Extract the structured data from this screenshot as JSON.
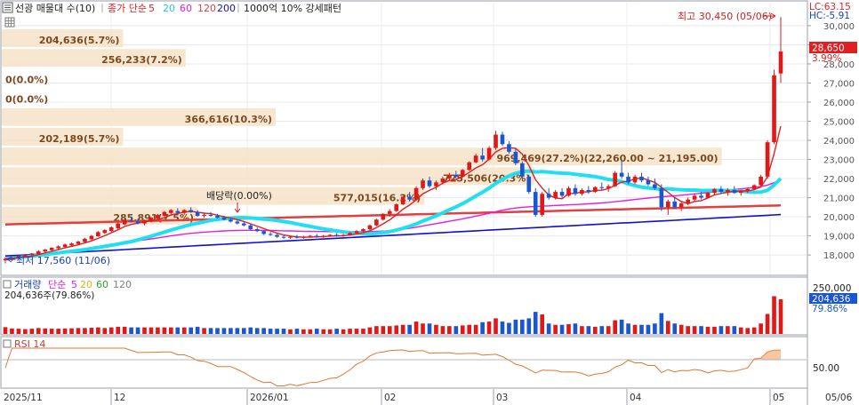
{
  "header": {
    "title": "선광 매물대 수(10)",
    "ma_label": "종가 단순",
    "ma_periods": [
      "5",
      "20",
      "60",
      "120",
      "200"
    ],
    "ma_colors": [
      "#e02020",
      "#20d0e0",
      "#e020e0",
      "#e04040",
      "#1010d0"
    ],
    "pattern_label": "1000억 10% 강세패턴",
    "lc": "LC:63.15",
    "hc": "HC:-5.91"
  },
  "price_panel": {
    "y_ticks": [
      "30,000",
      "29,000",
      "28,000",
      "27,000",
      "26,000",
      "25,000",
      "24,000",
      "23,000",
      "22,000",
      "21,000",
      "20,000",
      "19,000",
      "18,000"
    ],
    "current_price": "28,650",
    "current_change": "3.99%",
    "high_annotation": "최고 30,450 (05/06)",
    "low_annotation": "최저 17,560 (11/06)",
    "dividend_annotation": "배당락(0.00%)",
    "volume_profile": [
      {
        "label": "204,636(5.7%)",
        "width": 0.155
      },
      {
        "label": "256,233(7.2%)",
        "width": 0.235
      },
      {
        "label": "0(0.0%)",
        "width": 0
      },
      {
        "label": "0(0.0%)",
        "width": 0
      },
      {
        "label": "366,616(10.3%)",
        "width": 0.35
      },
      {
        "label": "202,189(5.7%)",
        "width": 0.155
      },
      {
        "label": "969,469(27.2%)(22,260.00 ~ 21,195.00)",
        "width": 0.92
      },
      {
        "label": "725,506(20.3%)",
        "width": 0.68
      },
      {
        "label": "577,015(16.2%)",
        "width": 0.54
      },
      {
        "label": "285,891(7.5%)",
        "width": 0.25
      }
    ]
  },
  "volume_panel": {
    "label": "거래량",
    "ma_label": "단순",
    "ma_periods": [
      "5",
      "20",
      "60",
      "120"
    ],
    "ma_colors": [
      "#e020e0",
      "#e0b020",
      "#30a030",
      "#808080"
    ],
    "last_volume": "204,636주(79.86%)",
    "y_ticks": [
      "250,000"
    ],
    "current_value": "204,636",
    "current_pct": "79.86%"
  },
  "rsi_panel": {
    "label": "RSI 14",
    "y_ticks": [
      "50.00"
    ]
  },
  "x_axis": {
    "labels": [
      "2025/11",
      "12",
      "2026/01",
      "02",
      "03",
      "04",
      "05"
    ],
    "right_label": "05/06"
  },
  "chart_data": {
    "type": "candlestick",
    "y_range": [
      17400,
      30600
    ],
    "candles": [
      [
        17720,
        17880,
        17560,
        17800
      ],
      [
        17780,
        17900,
        17680,
        17850
      ],
      [
        17850,
        18000,
        17800,
        17950
      ],
      [
        17920,
        18050,
        17880,
        18020
      ],
      [
        18000,
        18100,
        17900,
        18080
      ],
      [
        18050,
        18250,
        18000,
        18200
      ],
      [
        18180,
        18320,
        18100,
        18280
      ],
      [
        18250,
        18400,
        18200,
        18380
      ],
      [
        18350,
        18500,
        18300,
        18450
      ],
      [
        18420,
        18600,
        18380,
        18550
      ],
      [
        18500,
        18650,
        18420,
        18600
      ],
      [
        18580,
        18750,
        18500,
        18700
      ],
      [
        18680,
        18900,
        18650,
        18850
      ],
      [
        18820,
        19050,
        18780,
        19000
      ],
      [
        18980,
        19250,
        18950,
        19200
      ],
      [
        19150,
        19350,
        19100,
        19300
      ],
      [
        19250,
        19500,
        19200,
        19450
      ],
      [
        19400,
        19700,
        19350,
        19650
      ],
      [
        19600,
        19900,
        19550,
        19850
      ],
      [
        19800,
        20000,
        19700,
        19750
      ],
      [
        19750,
        19900,
        19600,
        19650
      ],
      [
        19650,
        19850,
        19550,
        19800
      ],
      [
        19780,
        20000,
        19700,
        19950
      ],
      [
        19900,
        20150,
        19850,
        20100
      ],
      [
        20050,
        20300,
        20000,
        20250
      ],
      [
        20200,
        20400,
        20100,
        20350
      ],
      [
        20300,
        20450,
        20150,
        20200
      ],
      [
        20200,
        20400,
        20100,
        20350
      ],
      [
        20350,
        20500,
        20200,
        20250
      ],
      [
        20250,
        20350,
        20000,
        20050
      ],
      [
        20050,
        20200,
        19950,
        20100
      ],
      [
        20100,
        20250,
        20000,
        20050
      ],
      [
        20050,
        20150,
        19900,
        19950
      ],
      [
        19950,
        20050,
        19800,
        19850
      ],
      [
        19850,
        19950,
        19700,
        19750
      ],
      [
        19750,
        19850,
        19600,
        19650
      ],
      [
        19650,
        19750,
        19500,
        19550
      ],
      [
        19550,
        19600,
        19300,
        19350
      ],
      [
        19350,
        19450,
        19200,
        19250
      ],
      [
        19250,
        19300,
        19050,
        19100
      ],
      [
        19100,
        19200,
        19000,
        19050
      ],
      [
        19050,
        19100,
        18900,
        18950
      ],
      [
        18950,
        19050,
        18850,
        18900
      ],
      [
        18900,
        19000,
        18850,
        18950
      ],
      [
        18950,
        19050,
        18850,
        18900
      ],
      [
        18900,
        19000,
        18850,
        18950
      ],
      [
        18950,
        19050,
        18900,
        19000
      ],
      [
        19000,
        19100,
        18900,
        18950
      ],
      [
        18950,
        19050,
        18900,
        19000
      ],
      [
        19000,
        19100,
        18950,
        19050
      ],
      [
        19050,
        19150,
        18950,
        19000
      ],
      [
        19000,
        19100,
        18950,
        19050
      ],
      [
        19050,
        19200,
        19000,
        19150
      ],
      [
        19150,
        19300,
        19100,
        19250
      ],
      [
        19250,
        19400,
        19200,
        19350
      ],
      [
        19350,
        19600,
        19300,
        19550
      ],
      [
        19550,
        19900,
        19500,
        19850
      ],
      [
        19850,
        20200,
        19800,
        20150
      ],
      [
        20150,
        20400,
        20000,
        20300
      ],
      [
        20300,
        20700,
        20250,
        20650
      ],
      [
        20650,
        21100,
        20600,
        21050
      ],
      [
        21050,
        21300,
        20800,
        20900
      ],
      [
        20900,
        21600,
        20850,
        21500
      ],
      [
        21500,
        22000,
        21400,
        21900
      ],
      [
        21900,
        22100,
        21500,
        21600
      ],
      [
        21600,
        21900,
        21400,
        21800
      ],
      [
        21800,
        22100,
        21700,
        22000
      ],
      [
        22000,
        22300,
        21900,
        22200
      ],
      [
        22200,
        22400,
        22000,
        22100
      ],
      [
        22100,
        22500,
        22050,
        22450
      ],
      [
        22450,
        22900,
        22400,
        22850
      ],
      [
        22850,
        23300,
        22800,
        23200
      ],
      [
        23200,
        23600,
        22900,
        23000
      ],
      [
        23000,
        23700,
        22950,
        23600
      ],
      [
        23600,
        24500,
        23500,
        24300
      ],
      [
        24300,
        24450,
        23700,
        23800
      ],
      [
        23800,
        23950,
        23300,
        23400
      ],
      [
        23400,
        23600,
        22700,
        22800
      ],
      [
        22800,
        22900,
        22000,
        22100
      ],
      [
        22100,
        22200,
        21200,
        21300
      ],
      [
        21300,
        21500,
        20000,
        20100
      ],
      [
        20100,
        21300,
        20000,
        21200
      ],
      [
        21200,
        21500,
        20900,
        21000
      ],
      [
        21000,
        21400,
        20900,
        21300
      ],
      [
        21300,
        21500,
        21000,
        21100
      ],
      [
        21100,
        21600,
        21050,
        21500
      ],
      [
        21500,
        21700,
        21100,
        21200
      ],
      [
        21200,
        21500,
        21100,
        21400
      ],
      [
        21400,
        21600,
        21200,
        21300
      ],
      [
        21300,
        21600,
        21250,
        21550
      ],
      [
        21550,
        21800,
        21400,
        21500
      ],
      [
        21500,
        21700,
        21300,
        21600
      ],
      [
        21600,
        22400,
        21550,
        22300
      ],
      [
        22300,
        22900,
        22000,
        22100
      ],
      [
        22100,
        22300,
        21700,
        21800
      ],
      [
        21800,
        22200,
        21700,
        22100
      ],
      [
        22100,
        22300,
        21800,
        21900
      ],
      [
        21900,
        22100,
        21600,
        21700
      ],
      [
        21700,
        22000,
        21400,
        21500
      ],
      [
        21500,
        21700,
        20300,
        20500
      ],
      [
        20500,
        20900,
        20100,
        20800
      ],
      [
        20800,
        21000,
        20400,
        20500
      ],
      [
        20500,
        20800,
        20300,
        20700
      ],
      [
        20700,
        21000,
        20600,
        20900
      ],
      [
        20900,
        21200,
        20800,
        21100
      ],
      [
        21100,
        21300,
        20900,
        21000
      ],
      [
        21000,
        21300,
        20950,
        21250
      ],
      [
        21250,
        21500,
        21150,
        21450
      ],
      [
        21450,
        21600,
        21200,
        21300
      ],
      [
        21300,
        21500,
        21100,
        21400
      ],
      [
        21400,
        21600,
        21200,
        21250
      ],
      [
        21250,
        21400,
        21100,
        21350
      ],
      [
        21350,
        21500,
        21250,
        21450
      ],
      [
        21450,
        21700,
        21400,
        21650
      ],
      [
        21650,
        22200,
        21600,
        22100
      ],
      [
        22100,
        24000,
        22000,
        23900
      ],
      [
        23900,
        27700,
        23800,
        27400
      ],
      [
        27500,
        30450,
        27000,
        28650
      ]
    ]
  }
}
